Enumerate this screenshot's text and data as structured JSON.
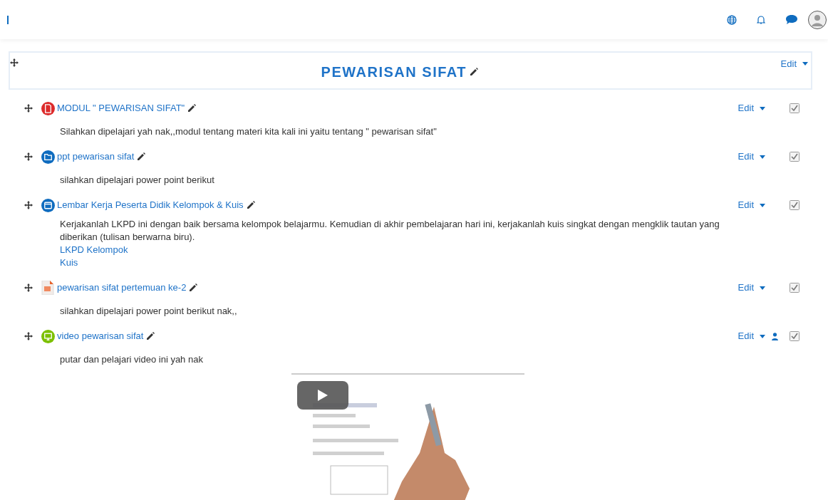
{
  "section": {
    "title": "PEWARISAN SIFAT",
    "edit_label": "Edit"
  },
  "activities": [
    {
      "kind": "pdf",
      "title": "MODUL \" PEWARISAN SIFAT\"",
      "edit_label": "Edit",
      "restricted": false,
      "checked": true,
      "description": [
        {
          "kind": "text",
          "text": "Silahkan dipelajari yah nak,,modul tentang materi kita kali ini yaitu tentang \" pewarisan sifat\""
        }
      ]
    },
    {
      "kind": "folder",
      "title": "ppt pewarisan sifat",
      "edit_label": "Edit",
      "restricted": false,
      "checked": true,
      "description": [
        {
          "kind": "text",
          "text": "silahkan dipelajari power point berikut"
        }
      ]
    },
    {
      "kind": "page",
      "title": "Lembar Kerja Peserta Didik Kelompok & Kuis",
      "edit_label": "Edit",
      "restricted": false,
      "checked": true,
      "description": [
        {
          "kind": "text",
          "text": "Kerjakanlah LKPD ini dengan baik bersama kelompok belajarmu. Kemudian di akhir pembelajaran hari ini, kerjakanlah kuis singkat dengan mengklik tautan yang diberikan (tulisan berwarna biru)."
        },
        {
          "kind": "link",
          "text": "LKPD Kelompok"
        },
        {
          "kind": "link",
          "text": "Kuis"
        }
      ]
    },
    {
      "kind": "ppt",
      "title": "pewarisan sifat pertemuan ke-2",
      "edit_label": "Edit",
      "restricted": false,
      "checked": true,
      "description": [
        {
          "kind": "text",
          "text": "silahkan dipelajari power point berikut nak,,"
        }
      ]
    },
    {
      "kind": "video",
      "title": "video pewarisan sifat",
      "edit_label": "Edit",
      "restricted": true,
      "checked": true,
      "description": [
        {
          "kind": "text",
          "text": "putar dan pelajari video ini yah nak"
        }
      ]
    }
  ]
}
